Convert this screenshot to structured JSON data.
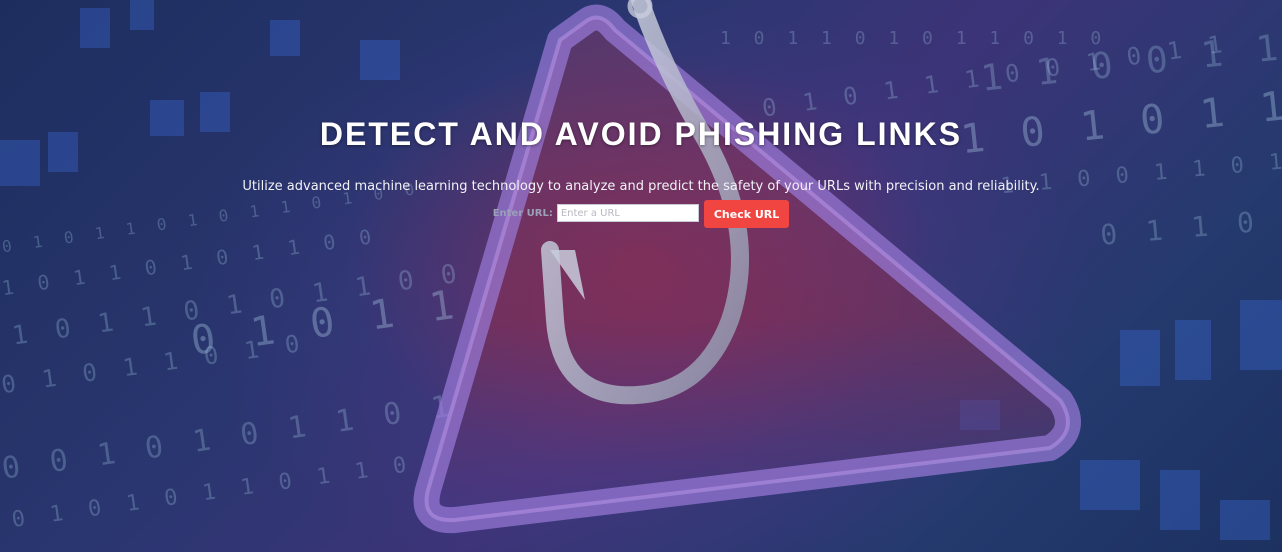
{
  "hero": {
    "title": "DETECT AND AVOID PHISHING LINKS",
    "subtitle": "Utilize advanced machine learning technology to analyze and predict the safety of your URLs with precision and reliability."
  },
  "form": {
    "label": "Enter URL:",
    "input_placeholder": "Enter a URL",
    "input_value": "",
    "submit_label": "Check URL"
  },
  "colors": {
    "button": "#f14541",
    "title": "#ffffff",
    "background_primary": "#2a3670",
    "background_accent": "#963046"
  },
  "background": {
    "image_icons": [
      "phishing-hook-icon",
      "warning-triangle-icon"
    ]
  }
}
